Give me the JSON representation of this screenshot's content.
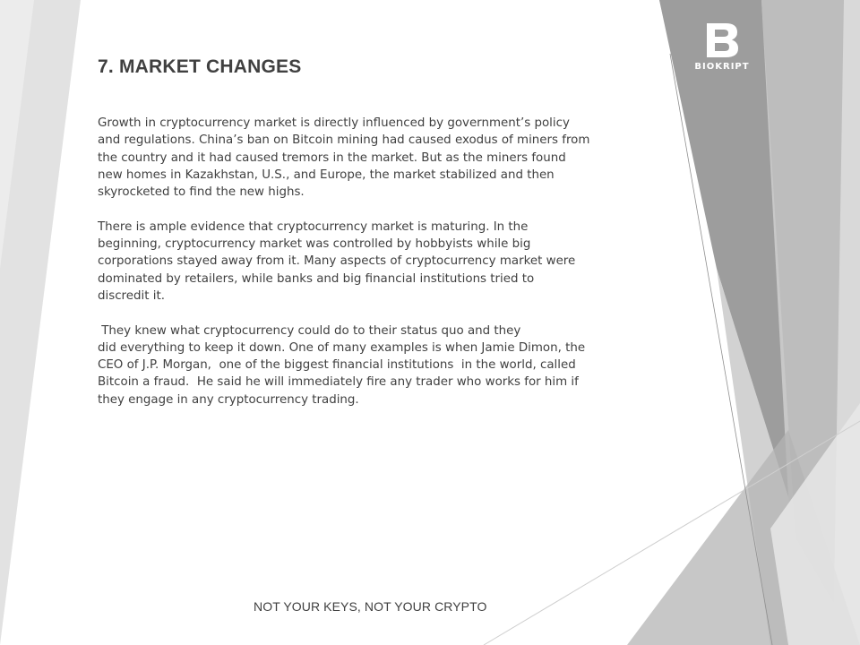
{
  "slide": {
    "title": "7. MARKET CHANGES",
    "paragraphs": [
      {
        "lines": [
          "Growth in cryptocurrency market is directly influenced by government’s policy",
          "and regulations.  China’s ban on Bitcoin mining had caused exodus of miners from",
          "the country  and it had caused tremors in the market. But as the miners found",
          "new homes in Kazakhstan, U.S., and Europe, the market stabilized and then",
          "skyrocketed to find the new highs."
        ]
      },
      {
        "lines": [
          "There is ample evidence that cryptocurrency market is maturing.  In the",
          "beginning, cryptocurrency market was controlled by hobbyists while big",
          "corporations stayed away from it. Many aspects of cryptocurrency market were",
          "dominated by retailers,  while banks and big financial institutions  tried to",
          "discredit it."
        ]
      },
      {
        "lines": [
          " They knew what cryptocurrency could do to their status quo and they",
          "did everything to keep it down. One of many examples is when Jamie Dimon, the",
          "CEO of J.P. Morgan,  one of the biggest financial institutions  in the world, called",
          "Bitcoin a fraud.  He said he will immediately fire any trader who works for him if",
          "they engage in any cryptocurrency trading."
        ]
      }
    ],
    "footer": "NOT YOUR KEYS, NOT YOUR CRYPTO"
  },
  "logo": {
    "letter": "B",
    "text": "BIOKRIPT"
  },
  "colors": {
    "text": "#404040",
    "logo": "#ffffff",
    "background": "#ffffff",
    "decor_dark": "#9a9a9a",
    "decor_mid": "#b8b8b8",
    "decor_light": "#d4d4d4"
  }
}
